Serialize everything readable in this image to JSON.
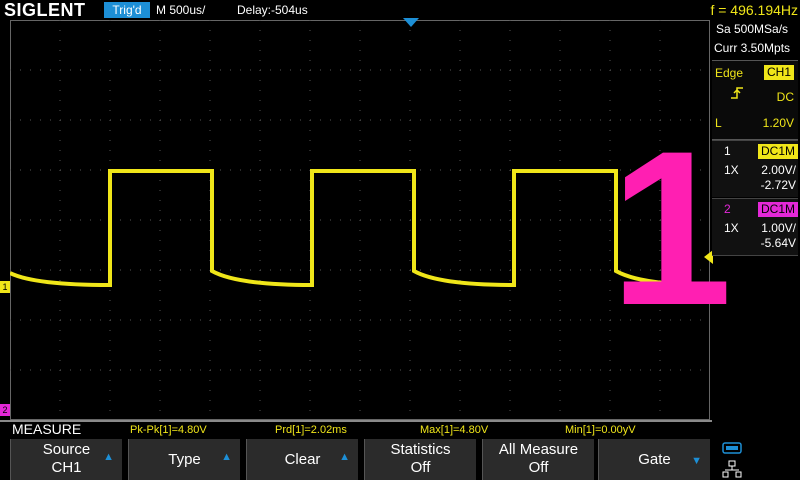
{
  "header": {
    "brand": "SIGLENT",
    "trigger_status": "Trig'd",
    "timebase": "M 500us/",
    "delay": "Delay:-504us",
    "frequency": "f = 496.194Hz"
  },
  "acquisition": {
    "sample_rate": "Sa 500MSa/s",
    "memory_depth": "Curr 3.50Mpts"
  },
  "trigger": {
    "type": "Edge",
    "source": "CH1",
    "coupling": "DC",
    "level_label": "L",
    "level": "1.20V"
  },
  "channels": [
    {
      "number": "1",
      "coupling": "DC1M",
      "probe": "1X",
      "scale": "2.00V/",
      "offset": "-2.72V"
    },
    {
      "number": "2",
      "coupling": "DC1M",
      "probe": "1X",
      "scale": "1.00V/",
      "offset": "-5.64V"
    }
  ],
  "markers": {
    "ch1": "1",
    "ch2": "2"
  },
  "measure": {
    "title": "MEASURE",
    "items": [
      "Pk-Pk[1]=4.80V",
      "Prd[1]=2.02ms",
      "Max[1]=4.80V",
      "Min[1]=0.00yV"
    ]
  },
  "softkeys": [
    {
      "line1": "Source",
      "line2": "CH1"
    },
    {
      "line1": "Type"
    },
    {
      "line1": "Clear"
    },
    {
      "line1": "Statistics",
      "line2": "Off"
    },
    {
      "line1": "All Measure",
      "line2": "Off"
    },
    {
      "line1": "Gate"
    }
  ],
  "overlay": {
    "label": "1"
  },
  "colors": {
    "ch1": "#f0e619",
    "ch2": "#e428d8",
    "accent": "#1d8fd6",
    "overlay": "#ff1fb2"
  }
}
